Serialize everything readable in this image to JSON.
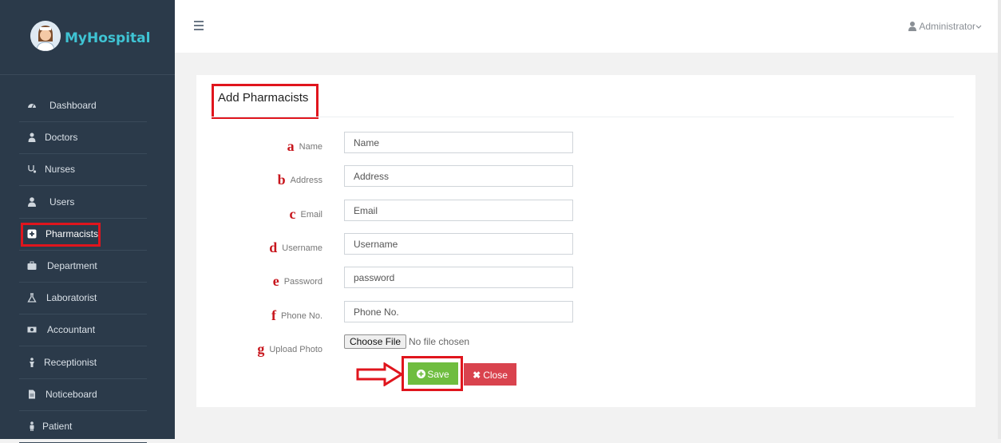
{
  "brand": {
    "name": "MyHospital"
  },
  "topbar": {
    "user": "Administrator"
  },
  "sidebar": {
    "items": [
      {
        "label": "Dashboard",
        "icon": "dashboard-icon"
      },
      {
        "label": "Doctors",
        "icon": "doctor-icon"
      },
      {
        "label": "Nurses",
        "icon": "stethoscope-icon"
      },
      {
        "label": "Users",
        "icon": "user-icon"
      },
      {
        "label": "Pharmacists",
        "icon": "plus-square-icon",
        "active": true
      },
      {
        "label": "Department",
        "icon": "briefcase-icon"
      },
      {
        "label": "Laboratorist",
        "icon": "flask-icon"
      },
      {
        "label": "Accountant",
        "icon": "money-icon"
      },
      {
        "label": "Receptionist",
        "icon": "person-icon"
      },
      {
        "label": "Noticeboard",
        "icon": "file-icon"
      },
      {
        "label": "Patient",
        "icon": "patient-icon"
      }
    ]
  },
  "form": {
    "title": "Add Pharmacists",
    "fields": [
      {
        "letter": "a",
        "label": "Name",
        "placeholder": "Name"
      },
      {
        "letter": "b",
        "label": "Address",
        "placeholder": "Address"
      },
      {
        "letter": "c",
        "label": "Email",
        "placeholder": "Email"
      },
      {
        "letter": "d",
        "label": "Username",
        "placeholder": "Username"
      },
      {
        "letter": "e",
        "label": "Password",
        "placeholder": "password"
      },
      {
        "letter": "f",
        "label": "Phone No.",
        "placeholder": "Phone No."
      }
    ],
    "photo": {
      "letter": "g",
      "label": "Upload Photo",
      "button": "Choose File",
      "status": "No file chosen"
    },
    "save_label": "Save",
    "close_label": "Close"
  },
  "colors": {
    "sidebar": "#2b3a4a",
    "accent": "#3fc3d3",
    "save": "#6fbd3f",
    "close": "#d9434e",
    "highlight": "#e0151d"
  }
}
